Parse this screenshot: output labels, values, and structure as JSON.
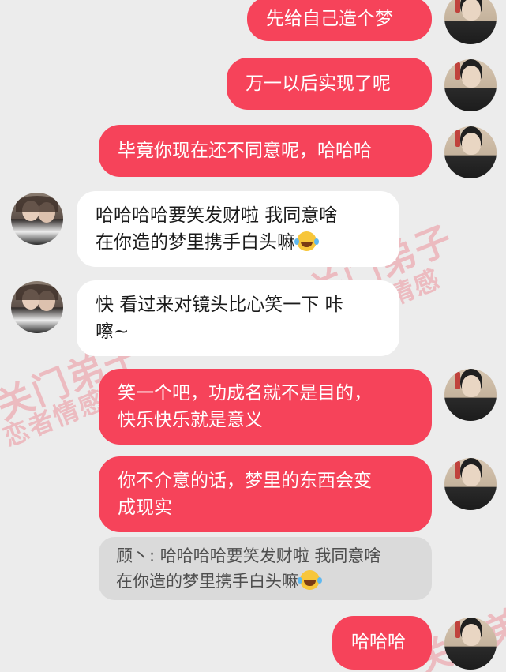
{
  "messages": [
    {
      "side": "sent",
      "text": "先给自己造个梦"
    },
    {
      "side": "sent",
      "text": "万一以后实现了呢"
    },
    {
      "side": "sent",
      "text": "毕竟你现在还不同意呢，哈哈哈"
    },
    {
      "side": "received",
      "line1": "哈哈哈哈要笑发财啦 我同意啥",
      "line2": "在你造的梦里携手白头嘛",
      "emoji": "laughing-tears-emoji"
    },
    {
      "side": "received",
      "line1": "快 看过来对镜头比心笑一下 咔",
      "line2": "嚓~"
    },
    {
      "side": "sent",
      "line1": "笑一个吧，功成名就不是目的，",
      "line2": "快乐快乐就是意义"
    },
    {
      "side": "sent",
      "line1": "你不介意的话，梦里的东西会变",
      "line2": "成现实"
    },
    {
      "side": "quote",
      "line1": "顾丶: 哈哈哈哈要笑发财啦 我同意啥",
      "line2": "在你造的梦里携手白头嘛",
      "emoji": "laughing-tears-emoji"
    },
    {
      "side": "sent",
      "text": "哈哈哈"
    }
  ],
  "watermark": {
    "main": "关门弟子",
    "sub": "恋者情感"
  },
  "colors": {
    "background": "#ececec",
    "sent_bubble": "#f6435a",
    "received_bubble": "#ffffff",
    "quote_bubble": "#dadada"
  }
}
